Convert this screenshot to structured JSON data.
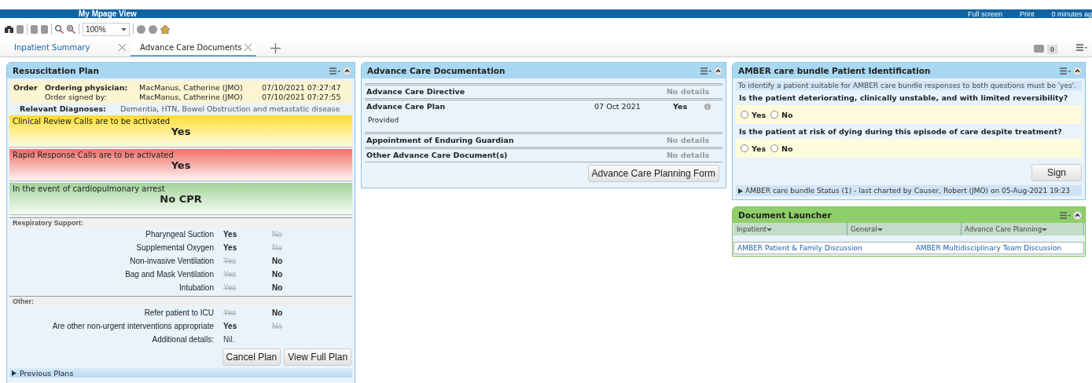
{
  "header": {
    "title": "My Mpage View",
    "actions": [
      "Full screen",
      "Print",
      "0 minutes ag"
    ]
  },
  "toolbar": {
    "zoom": "100%"
  },
  "tabs": [
    {
      "label": "Inpatient Summary",
      "selected": false
    },
    {
      "label": "Advance Care Documents",
      "selected": true
    }
  ],
  "notifications": {
    "count": "0"
  },
  "resus": {
    "title": "Resuscitation Plan",
    "order_label": "Order",
    "order_rows": [
      {
        "label": "Ordering physician:",
        "bold": true,
        "name": "MacManus, Catherine (JMO)",
        "time": "07/10/2021 07:27:47"
      },
      {
        "label": "Order signed by:",
        "bold": false,
        "name": "MacManus, Catherine (JMO)",
        "time": "07/10/2021 07:27:55"
      }
    ],
    "diagnoses_label": "Relevant Diagnoses:",
    "diagnoses": "Dementia, HTN, Bowel Obstruction and metastatic disease",
    "alerts": [
      {
        "kind": "amber",
        "title": "Clinical Review Calls are to be activated",
        "value": "Yes"
      },
      {
        "kind": "red",
        "title": "Rapid Response Calls are to be activated",
        "value": "Yes"
      },
      {
        "kind": "green",
        "title": "In the event of cardiopulmonary arrest",
        "value": "No CPR"
      }
    ],
    "sections": [
      {
        "title": "Respiratory Support:",
        "rows": [
          {
            "label": "Pharyngeal Suction",
            "options": [
              {
                "label": "Yes",
                "selected": true
              },
              {
                "label": "No",
                "selected": false
              }
            ]
          },
          {
            "label": "Supplemental Oxygen",
            "options": [
              {
                "label": "Yes",
                "selected": true
              },
              {
                "label": "No",
                "selected": false
              }
            ]
          },
          {
            "label": "Non-invasive Ventilation",
            "options": [
              {
                "label": "Yes",
                "selected": false
              },
              {
                "label": "No",
                "selected": true
              }
            ]
          },
          {
            "label": "Bag and Mask Ventilation",
            "options": [
              {
                "label": "Yes",
                "selected": false
              },
              {
                "label": "No",
                "selected": true
              }
            ]
          },
          {
            "label": "Intubation",
            "options": [
              {
                "label": "Yes",
                "selected": false
              },
              {
                "label": "No",
                "selected": true
              }
            ]
          }
        ]
      },
      {
        "title": "Other:",
        "rows": [
          {
            "label": "Refer patient to ICU",
            "options": [
              {
                "label": "Yes",
                "selected": false
              },
              {
                "label": "No",
                "selected": true
              }
            ]
          },
          {
            "label": "Are other non-urgent interventions appropriate",
            "options": [
              {
                "label": "Yes",
                "selected": true
              },
              {
                "label": "No",
                "selected": false
              }
            ]
          }
        ]
      }
    ],
    "details_label": "Additional details:",
    "details": "Nil.",
    "buttons": [
      "Cancel Plan",
      "View Full Plan"
    ],
    "previous": "Previous Plans"
  },
  "documentation": {
    "title": "Advance Care Documentation",
    "items": [
      {
        "name": "Advance Care Directive",
        "status": "No details"
      },
      {
        "name": "Advance Care Plan",
        "date": "07 Oct 2021",
        "value": "Yes",
        "note": "Provided"
      },
      {
        "name": "Appointment of Enduring Guardian",
        "status": "No details"
      },
      {
        "name": "Other Advance Care Document(s)",
        "status": "No details"
      }
    ],
    "button": "Advance Care Planning Form"
  },
  "amber": {
    "title": "AMBER care bundle Patient Identification",
    "intro": "To identify a patient suitable for AMBER care bundle responses to both questions must be 'yes'.",
    "questions": [
      {
        "text": "Is the patient deteriorating, clinically unstable, and with limited reversibility?",
        "options": [
          {
            "label": "Yes",
            "checked": false
          },
          {
            "label": "No",
            "checked": false
          }
        ]
      },
      {
        "text": "Is the patient at risk of dying during this episode of care despite treatment?",
        "options": [
          {
            "label": "Yes",
            "checked": false
          },
          {
            "label": "No",
            "checked": false
          }
        ]
      }
    ],
    "button": "Sign",
    "status": "AMBER care bundle Status (1) - last charted by Causer, Robert (JMO) on 05-Aug-2021 19:23"
  },
  "launcher": {
    "title": "Document Launcher",
    "columns": [
      "Inpatient",
      "General",
      "Advance Care Planning"
    ],
    "links": [
      "AMBER Patient & Family Discussion",
      "AMBER Multidisciplinary Team Discussion"
    ]
  }
}
